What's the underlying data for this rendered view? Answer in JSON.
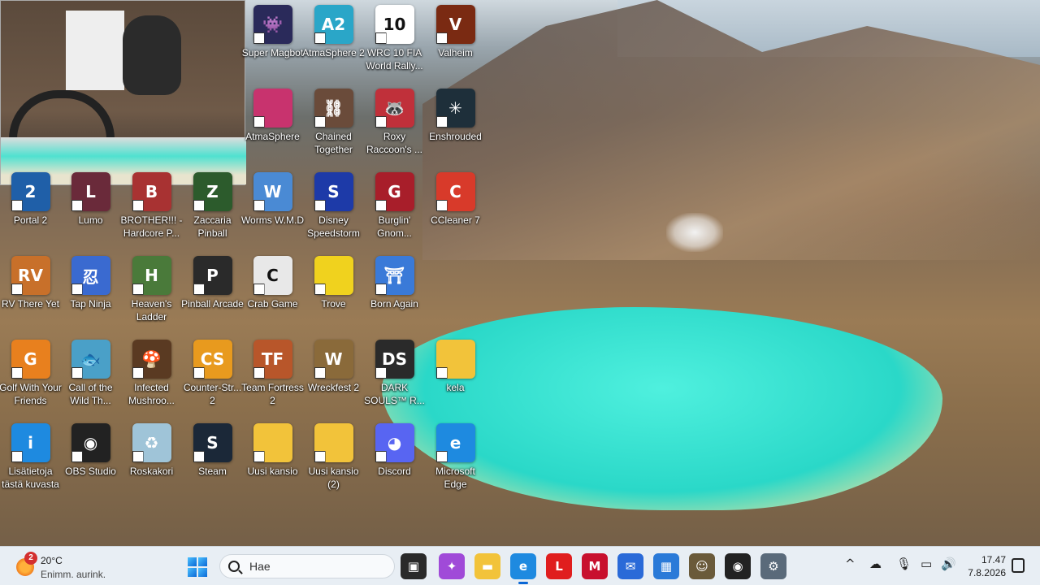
{
  "desktop_icons": [
    {
      "label": "Super Magbot",
      "icon": "super-magbot-icon",
      "color": "#2a2a5a",
      "glyph": "👾"
    },
    {
      "label": "AtmaSphere 2",
      "icon": "atmasphere2-icon",
      "color": "#2aa6c8",
      "glyph": "A2"
    },
    {
      "label": "WRC 10 FIA World Rally...",
      "icon": "wrc10-icon",
      "color": "#ffffff",
      "glyph": "10"
    },
    {
      "label": "Valheim",
      "icon": "valheim-icon",
      "color": "#7a2a12",
      "glyph": "V"
    },
    {
      "label": "AtmaSphere",
      "icon": "atmasphere-icon",
      "color": "#c8336e",
      "glyph": ""
    },
    {
      "label": "Chained Together",
      "icon": "chained-together-icon",
      "color": "#6a4b3a",
      "glyph": "⛓"
    },
    {
      "label": "Roxy Raccoon's ...",
      "icon": "roxy-raccoon-icon",
      "color": "#c0303a",
      "glyph": "🦝"
    },
    {
      "label": "Enshrouded",
      "icon": "enshrouded-icon",
      "color": "#1e2f3a",
      "glyph": "✳"
    },
    {
      "label": "Portal 2",
      "icon": "portal2-icon",
      "color": "#1f5fa8",
      "glyph": "2"
    },
    {
      "label": "Lumo",
      "icon": "lumo-icon",
      "color": "#6a2a3a",
      "glyph": "L"
    },
    {
      "label": "BROTHER!!! - Hardcore P...",
      "icon": "brother-icon",
      "color": "#a83232",
      "glyph": "B"
    },
    {
      "label": "Zaccaria Pinball",
      "icon": "zaccaria-pinball-icon",
      "color": "#2c5b2c",
      "glyph": "Z"
    },
    {
      "label": "Worms W.M.D",
      "icon": "worms-wmd-icon",
      "color": "#4a8ad4",
      "glyph": "W"
    },
    {
      "label": "Disney Speedstorm",
      "icon": "disney-speedstorm-icon",
      "color": "#1d3aa8",
      "glyph": "S"
    },
    {
      "label": "Burglin' Gnom...",
      "icon": "burglin-gnomes-icon",
      "color": "#a81e2a",
      "glyph": "G"
    },
    {
      "label": "CCleaner 7",
      "icon": "ccleaner-icon",
      "color": "#d83a2a",
      "glyph": "C"
    },
    {
      "label": "RV There Yet",
      "icon": "rv-there-yet-icon",
      "color": "#c8702a",
      "glyph": "RV"
    },
    {
      "label": "Tap Ninja",
      "icon": "tap-ninja-icon",
      "color": "#3a6ad0",
      "glyph": "忍"
    },
    {
      "label": "Heaven's Ladder",
      "icon": "heavens-ladder-icon",
      "color": "#4a7a3a",
      "glyph": "H"
    },
    {
      "label": "Pinball Arcade",
      "icon": "pinball-arcade-icon",
      "color": "#2a2a2a",
      "glyph": "P"
    },
    {
      "label": "Crab Game",
      "icon": "crab-game-icon",
      "color": "#e8e8e8",
      "glyph": "C"
    },
    {
      "label": "Trove",
      "icon": "trove-icon",
      "color": "#f0d21e",
      "glyph": ""
    },
    {
      "label": "Born Again",
      "icon": "born-again-icon",
      "color": "#3a7ad8",
      "glyph": "⛩"
    },
    {
      "label": "Golf With Your Friends",
      "icon": "golf-with-friends-icon",
      "color": "#e8801e",
      "glyph": "G"
    },
    {
      "label": "Call of the Wild Th...",
      "icon": "call-of-the-wild-icon",
      "color": "#4aa0c8",
      "glyph": "🐟"
    },
    {
      "label": "Infected Mushroo...",
      "icon": "infected-mushroom-icon",
      "color": "#5a3a22",
      "glyph": "🍄"
    },
    {
      "label": "Counter-Str... 2",
      "icon": "counter-strike-icon",
      "color": "#e89a1e",
      "glyph": "CS"
    },
    {
      "label": "Team Fortress 2",
      "icon": "team-fortress-icon",
      "color": "#b8562a",
      "glyph": "TF"
    },
    {
      "label": "Wreckfest 2",
      "icon": "wreckfest2-icon",
      "color": "#8a6a3a",
      "glyph": "W"
    },
    {
      "label": "DARK SOULS™ R...",
      "icon": "dark-souls-icon",
      "color": "#2a2a2a",
      "glyph": "DS"
    },
    {
      "label": "kela",
      "icon": "folder-icon",
      "color": "#f2c33a",
      "glyph": ""
    },
    {
      "label": "Lisätietoja tästä kuvasta",
      "icon": "info-picture-icon",
      "color": "#1e8ae0",
      "glyph": "i"
    },
    {
      "label": "OBS Studio",
      "icon": "obs-studio-icon",
      "color": "#222222",
      "glyph": "◉"
    },
    {
      "label": "Roskakori",
      "icon": "recycle-bin-icon",
      "color": "#9fc4d8",
      "glyph": "♻"
    },
    {
      "label": "Steam",
      "icon": "steam-icon",
      "color": "#1b2838",
      "glyph": "S"
    },
    {
      "label": "Uusi kansio",
      "icon": "folder-icon",
      "color": "#f2c33a",
      "glyph": ""
    },
    {
      "label": "Uusi kansio (2)",
      "icon": "folder-icon",
      "color": "#f2c33a",
      "glyph": ""
    },
    {
      "label": "Discord",
      "icon": "discord-icon",
      "color": "#5865f2",
      "glyph": "◕"
    },
    {
      "label": "Microsoft Edge",
      "icon": "edge-icon",
      "color": "#1e8ae0",
      "glyph": "e"
    }
  ],
  "taskbar": {
    "weather": {
      "badge": "2",
      "temp": "20°C",
      "condition": "Enimm. aurink."
    },
    "search": {
      "placeholder": "Hae"
    },
    "apps": [
      {
        "name": "task-view-icon",
        "color": "#2a2a2a",
        "glyph": "▣"
      },
      {
        "name": "copilot-icon",
        "color": "#a04ad8",
        "glyph": "✦"
      },
      {
        "name": "file-explorer-icon",
        "color": "#f2c33a",
        "glyph": "▬"
      },
      {
        "name": "edge-icon",
        "color": "#1e8ae0",
        "glyph": "e"
      },
      {
        "name": "lenovo-icon",
        "color": "#e01e1e",
        "glyph": "L"
      },
      {
        "name": "mcafee-icon",
        "color": "#c8102e",
        "glyph": "M"
      },
      {
        "name": "outlook-icon",
        "color": "#2a6ad8",
        "glyph": "✉"
      },
      {
        "name": "microsoft-store-icon",
        "color": "#2a7ad8",
        "glyph": "▦"
      },
      {
        "name": "game-app-icon",
        "color": "#6a5a3a",
        "glyph": "☺"
      },
      {
        "name": "obs-studio-icon",
        "color": "#222222",
        "glyph": "◉"
      },
      {
        "name": "settings-icon",
        "color": "#5a6a7a",
        "glyph": "⚙"
      }
    ],
    "tray": {
      "chevron": "^",
      "network": "☁",
      "microphone": "🎙",
      "display": "▭",
      "volume": "🔊"
    },
    "clock": {
      "time": "17.47",
      "date": "7.8.2026"
    }
  }
}
